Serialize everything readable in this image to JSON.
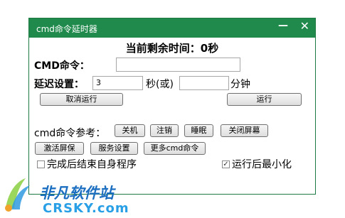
{
  "window": {
    "title": "cmd命令延时器",
    "minimize_glyph": "—",
    "close_glyph": "✕"
  },
  "status": {
    "text": "当前剩余时间：0秒"
  },
  "cmd": {
    "label": "CMD命令：",
    "value": ""
  },
  "delay": {
    "label": "延迟设置：",
    "seconds_value": "3",
    "seconds_unit": "秒(或)",
    "minutes_value": "",
    "minutes_unit": "分钟"
  },
  "actions": {
    "cancel_label": "取消运行",
    "run_label": "运行"
  },
  "reference": {
    "label": "cmd命令参考：",
    "row1": [
      "关机",
      "注销",
      "睡眠",
      "关闭屏幕"
    ],
    "row2": [
      "激活屏保",
      "服务设置",
      "更多cmd命令"
    ]
  },
  "options": {
    "exit_after_label": "完成后结束自身程序",
    "exit_after_checked": false,
    "minimize_after_label": "运行后最小化",
    "minimize_after_checked": true,
    "check_glyph": "✓"
  },
  "watermark": {
    "text_cn": "非凡软件站",
    "text_en": "CRSKY.com"
  }
}
